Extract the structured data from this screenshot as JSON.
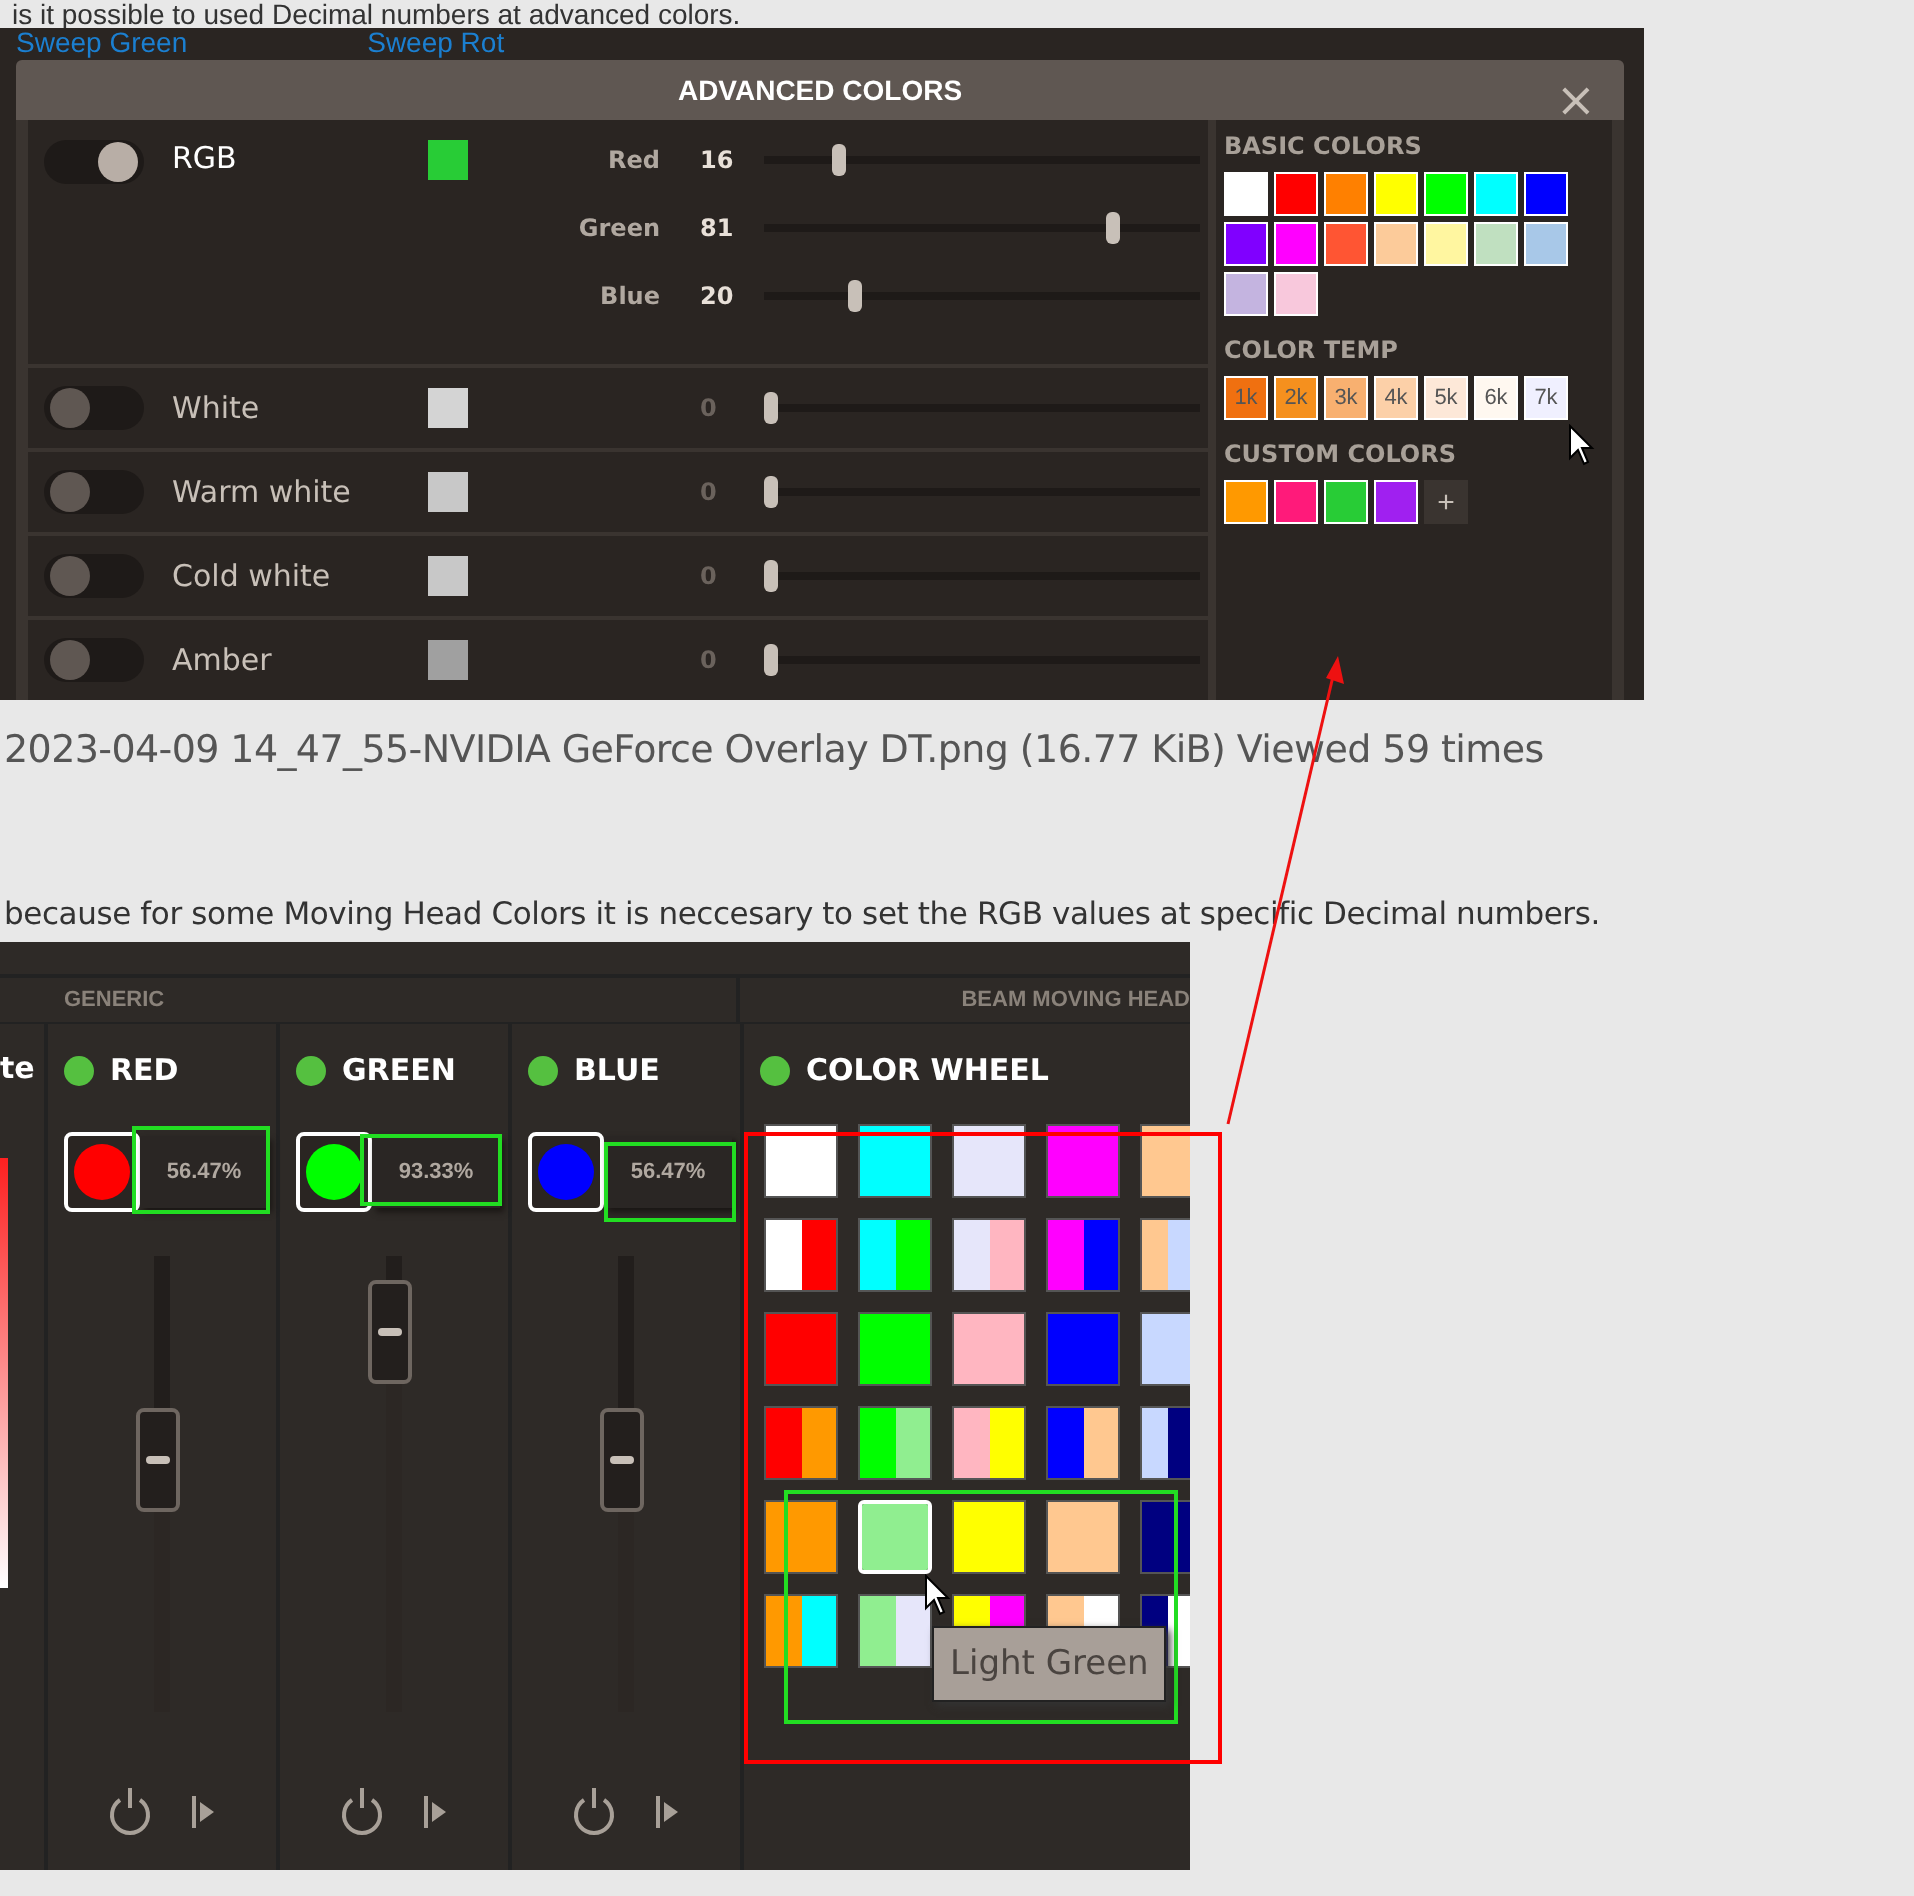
{
  "post_text_top": "is it possible to used Decimal numbers at advanced colors.",
  "screenshot_1": {
    "background_links": [
      "Sweep Green",
      "Sweep Rot"
    ],
    "dialog": {
      "title": "ADVANCED COLORS",
      "close": "×",
      "rgb": {
        "label": "RGB",
        "on": true,
        "color": "#28cc36",
        "sliders": [
          {
            "label": "Red",
            "value": "16",
            "level": 0.16
          },
          {
            "label": "Green",
            "value": "81",
            "level": 0.81
          },
          {
            "label": "Blue",
            "value": "20",
            "level": 0.2
          }
        ]
      },
      "channels": [
        {
          "label": "White",
          "on": false,
          "color": "#d4d4d4",
          "value": "0",
          "level": 0
        },
        {
          "label": "Warm white",
          "on": false,
          "color": "#c8c8c8",
          "value": "0",
          "level": 0
        },
        {
          "label": "Cold white",
          "on": false,
          "color": "#c8c8c8",
          "value": "0",
          "level": 0
        },
        {
          "label": "Amber",
          "on": false,
          "color": "#a0a0a0",
          "value": "0",
          "level": 0
        }
      ],
      "basic_colors": {
        "title": "BASIC COLORS",
        "swatches": [
          {
            "color": "#ffffff"
          },
          {
            "color": "#ff0000"
          },
          {
            "color": "#ff8000"
          },
          {
            "color": "#ffff00"
          },
          {
            "color": "#00ff00"
          },
          {
            "color": "#00ffff"
          },
          {
            "color": "#0000ff"
          },
          {
            "color": "#8000ff"
          },
          {
            "color": "#ff00ff"
          },
          {
            "color": "#ff5533"
          },
          {
            "color": "#fccb9a"
          },
          {
            "color": "#fff6a0"
          },
          {
            "color": "#c0e0c0"
          },
          {
            "color": "#a8c8e8"
          },
          {
            "color": "#c4b4e0"
          },
          {
            "color": "#f8c8dc"
          }
        ]
      },
      "color_temp": {
        "title": "COLOR TEMP",
        "swatches": [
          {
            "label": "1k",
            "color": "#f07010"
          },
          {
            "label": "2k",
            "color": "#f5901e"
          },
          {
            "label": "3k",
            "color": "#f8b070"
          },
          {
            "label": "4k",
            "color": "#fcd0a8"
          },
          {
            "label": "5k",
            "color": "#fde8d8"
          },
          {
            "label": "6k",
            "color": "#fff8f0"
          },
          {
            "label": "7k",
            "color": "#f0f0ff"
          }
        ]
      },
      "custom_colors": {
        "title": "CUSTOM COLORS",
        "add": "+",
        "swatches": [
          {
            "color": "#ff9900"
          },
          {
            "color": "#ff1a7a"
          },
          {
            "color": "#28cc36"
          },
          {
            "color": "#a020f0"
          }
        ]
      }
    }
  },
  "caption": "2023-04-09 14_47_55-NVIDIA GeForce Overlay DT.png (16.77 KiB) Viewed 59 times",
  "post_text": "because for some Moving Head Colors it is neccesary to set the RGB values at specific Decimal numbers.",
  "screenshot_2": {
    "left_cut_label": "te",
    "sections": [
      {
        "title": "GENERIC"
      },
      {
        "title": "BEAM MOVING HEAD"
      }
    ],
    "faders": [
      {
        "label": "RED",
        "active": true,
        "color": "#ff0000",
        "value": "56.47%",
        "level": 0.5647
      },
      {
        "label": "GREEN",
        "active": true,
        "color": "#00ff00",
        "value": "93.33%",
        "level": 0.9333
      },
      {
        "label": "BLUE",
        "active": true,
        "color": "#0000ff",
        "value": "56.47%",
        "level": 0.5647
      }
    ],
    "color_wheel": {
      "label": "COLOR WHEEL",
      "active": true,
      "tooltip": "Light Green",
      "swatches": [
        {
          "halves": [
            {
              "color": "#ffffff"
            }
          ],
          "selected": false
        },
        {
          "halves": [
            {
              "color": "#00ffff"
            }
          ],
          "selected": false
        },
        {
          "halves": [
            {
              "color": "#e6e6fa"
            }
          ],
          "selected": false
        },
        {
          "halves": [
            {
              "color": "#ff00ff"
            }
          ],
          "selected": false
        },
        {
          "halves": [
            {
              "color": "#ffc890"
            }
          ],
          "selected": false
        },
        {
          "halves": [
            {
              "color": "#ffffff"
            },
            {
              "color": "#ff0000"
            }
          ],
          "selected": false
        },
        {
          "halves": [
            {
              "color": "#00ffff"
            },
            {
              "color": "#00ff00"
            }
          ],
          "selected": false
        },
        {
          "halves": [
            {
              "color": "#e6e6fa"
            },
            {
              "color": "#ffb6c1"
            }
          ],
          "selected": false
        },
        {
          "halves": [
            {
              "color": "#ff00ff"
            },
            {
              "color": "#0000ff"
            }
          ],
          "selected": false
        },
        {
          "halves": [
            {
              "color": "#ffc890"
            },
            {
              "color": "#c8d8ff"
            }
          ],
          "selected": false
        },
        {
          "halves": [
            {
              "color": "#ff0000"
            }
          ],
          "selected": false
        },
        {
          "halves": [
            {
              "color": "#00ff00"
            }
          ],
          "selected": false
        },
        {
          "halves": [
            {
              "color": "#ffb6c1"
            }
          ],
          "selected": false
        },
        {
          "halves": [
            {
              "color": "#0000ff"
            }
          ],
          "selected": false
        },
        {
          "halves": [
            {
              "color": "#c8d8ff"
            }
          ],
          "selected": false
        },
        {
          "halves": [
            {
              "color": "#ff0000"
            },
            {
              "color": "#ff9900"
            }
          ],
          "selected": false
        },
        {
          "halves": [
            {
              "color": "#00ff00"
            },
            {
              "color": "#90ee90"
            }
          ],
          "selected": false
        },
        {
          "halves": [
            {
              "color": "#ffb6c1"
            },
            {
              "color": "#ffff00"
            }
          ],
          "selected": false
        },
        {
          "halves": [
            {
              "color": "#0000ff"
            },
            {
              "color": "#ffc890"
            }
          ],
          "selected": false
        },
        {
          "halves": [
            {
              "color": "#c8d8ff"
            },
            {
              "color": "#000080"
            }
          ],
          "selected": false
        },
        {
          "halves": [
            {
              "color": "#ff9900"
            }
          ],
          "selected": false
        },
        {
          "halves": [
            {
              "color": "#90ee90"
            }
          ],
          "selected": true
        },
        {
          "halves": [
            {
              "color": "#ffff00"
            }
          ],
          "selected": false
        },
        {
          "halves": [
            {
              "color": "#ffc890"
            }
          ],
          "selected": false
        },
        {
          "halves": [
            {
              "color": "#000080"
            }
          ],
          "selected": false
        },
        {
          "halves": [
            {
              "color": "#ff9900"
            },
            {
              "color": "#00ffff"
            }
          ],
          "selected": false
        },
        {
          "halves": [
            {
              "color": "#90ee90"
            },
            {
              "color": "#e6e6fa"
            }
          ],
          "selected": false
        },
        {
          "halves": [
            {
              "color": "#ffff00"
            },
            {
              "color": "#ff00ff"
            }
          ],
          "selected": false
        },
        {
          "halves": [
            {
              "color": "#ffc890"
            },
            {
              "color": "#ffffff"
            }
          ],
          "selected": false
        },
        {
          "halves": [
            {
              "color": "#000080"
            },
            {
              "color": "#ffffff"
            }
          ],
          "selected": false
        }
      ]
    }
  }
}
